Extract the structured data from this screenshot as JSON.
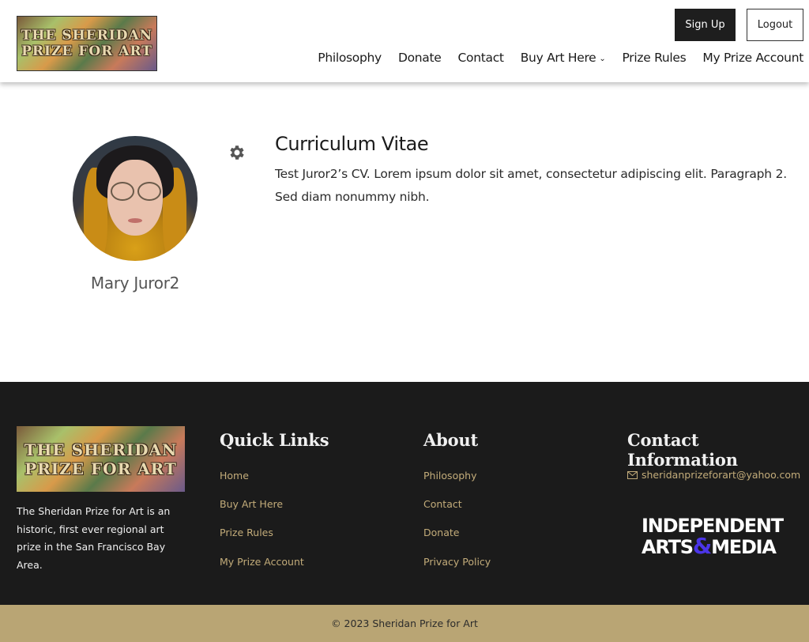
{
  "header": {
    "logo_text": "THE SHERIDAN\nPRIZE FOR ART",
    "signup_label": "Sign Up",
    "logout_label": "Logout",
    "nav": [
      {
        "label": "Philosophy"
      },
      {
        "label": "Donate"
      },
      {
        "label": "Contact"
      },
      {
        "label": "Buy Art Here",
        "has_dropdown": true
      },
      {
        "label": "Prize Rules"
      },
      {
        "label": "My Prize Account"
      }
    ]
  },
  "profile": {
    "name": "Mary Juror2",
    "settings_icon": "gear-icon",
    "cv_title": "Curriculum Vitae",
    "cv_text": "Test Juror2’s CV. Lorem ipsum dolor sit amet, consectetur adipiscing elit. Paragraph 2. Sed diam nonummy nibh."
  },
  "footer": {
    "logo_text": "THE SHERIDAN\nPRIZE FOR ART",
    "description": "The Sheridan Prize for Art is an historic, first ever regional art prize in the San Francisco Bay Area.",
    "quick_links": {
      "heading": "Quick Links",
      "items": [
        "Home",
        "Buy Art Here",
        "Prize Rules",
        "My Prize Account"
      ]
    },
    "about": {
      "heading": "About",
      "items": [
        "Philosophy",
        "Contact",
        "Donate",
        "Privacy Policy"
      ]
    },
    "contact": {
      "heading": "Contact Information",
      "email": "sheridanprizeforart@yahoo.com",
      "email_icon": "mail-icon"
    },
    "partner_logo": {
      "line1": "INDEPENDENT",
      "line2_a": "ARTS",
      "amp": "&",
      "line2_b": "MEDIA"
    }
  },
  "copyright": "© 2023 Sheridan Prize for Art",
  "colors": {
    "footer_bg": "#1b1b1b",
    "link_gold": "#c3ac7a",
    "bottom_bar": "#b9a574",
    "partner_accent": "#4b35e8"
  }
}
